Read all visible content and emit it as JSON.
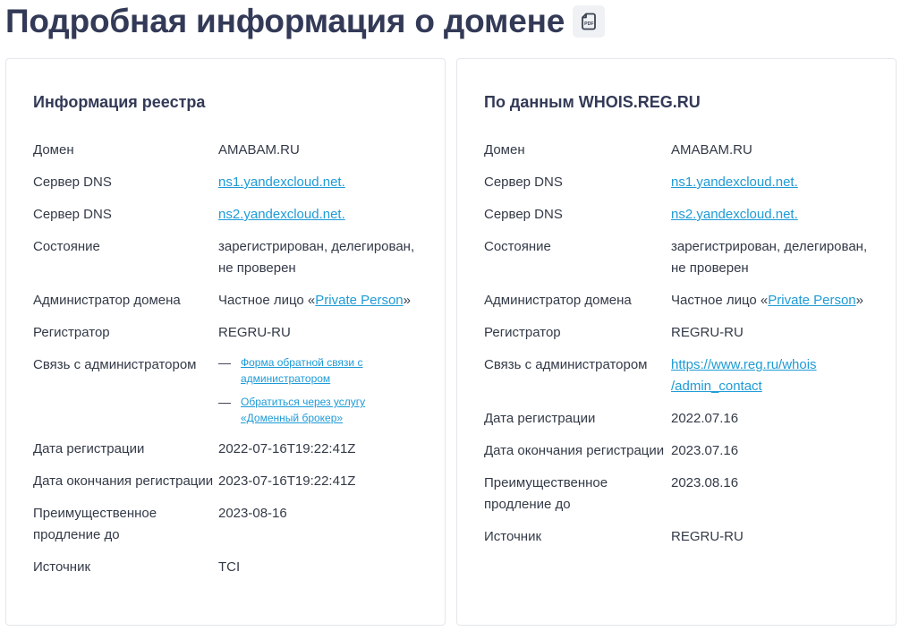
{
  "header": {
    "title": "Подробная информация о домене",
    "pdf_icon": "pdf-file-icon"
  },
  "registry": {
    "title": "Информация реестра",
    "rows": {
      "domain": {
        "label": "Домен",
        "value": "AMABAM.RU"
      },
      "dns1": {
        "label": "Сервер DNS",
        "value": "ns1.yandexcloud.net."
      },
      "dns2": {
        "label": "Сервер DNS",
        "value": "ns2.yandexcloud.net."
      },
      "status": {
        "label": "Состояние",
        "value": "зарегистрирован, делегирован, не проверен"
      },
      "admin": {
        "label": "Администратор домена",
        "prefix": "Частное лицо «",
        "link": "Private Person",
        "suffix": "»"
      },
      "registrar": {
        "label": "Регистратор",
        "value": "REGRU-RU"
      },
      "contact": {
        "label": "Связь с администратором",
        "links": [
          {
            "dash": "—",
            "text": "Форма обратной связи с администратором"
          },
          {
            "dash": "—",
            "text": "Обратиться через услугу «Доменный брокер»"
          }
        ]
      },
      "created": {
        "label": "Дата регистрации",
        "value": "2022-07-16T19:22:41Z"
      },
      "expires": {
        "label": "Дата окончания регистрации",
        "value": "2023-07-16T19:22:41Z"
      },
      "renewal": {
        "label": "Преимущественное продление до",
        "value": "2023-08-16"
      },
      "source": {
        "label": "Источник",
        "value": "TCI"
      }
    }
  },
  "whois": {
    "title": "По данным WHOIS.REG.RU",
    "rows": {
      "domain": {
        "label": "Домен",
        "value": "AMABAM.RU"
      },
      "dns1": {
        "label": "Сервер DNS",
        "value": "ns1.yandexcloud.net."
      },
      "dns2": {
        "label": "Сервер DNS",
        "value": "ns2.yandexcloud.net."
      },
      "status": {
        "label": "Состояние",
        "value": "зарегистрирован, делегирован, не проверен"
      },
      "admin": {
        "label": "Администратор домена",
        "prefix": "Частное лицо «",
        "link": "Private Person",
        "suffix": "»"
      },
      "registrar": {
        "label": "Регистратор",
        "value": "REGRU-RU"
      },
      "contact": {
        "label": "Связь с администратором",
        "link_line1": "https://www.reg.ru/whois",
        "link_line2": "/admin_contact"
      },
      "created": {
        "label": "Дата регистрации",
        "value": "2022.07.16"
      },
      "expires": {
        "label": "Дата окончания регистрации",
        "value": "2023.07.16"
      },
      "renewal": {
        "label": "Преимущественное продление до",
        "value": "2023.08.16"
      },
      "source": {
        "label": "Источник",
        "value": "REGRU-RU"
      }
    }
  },
  "colors": {
    "title": "#333a57",
    "text": "#333a47",
    "link": "#1e9bd6",
    "card_border": "#e3e6ea",
    "pdf_button_bg": "#eff1f4"
  }
}
